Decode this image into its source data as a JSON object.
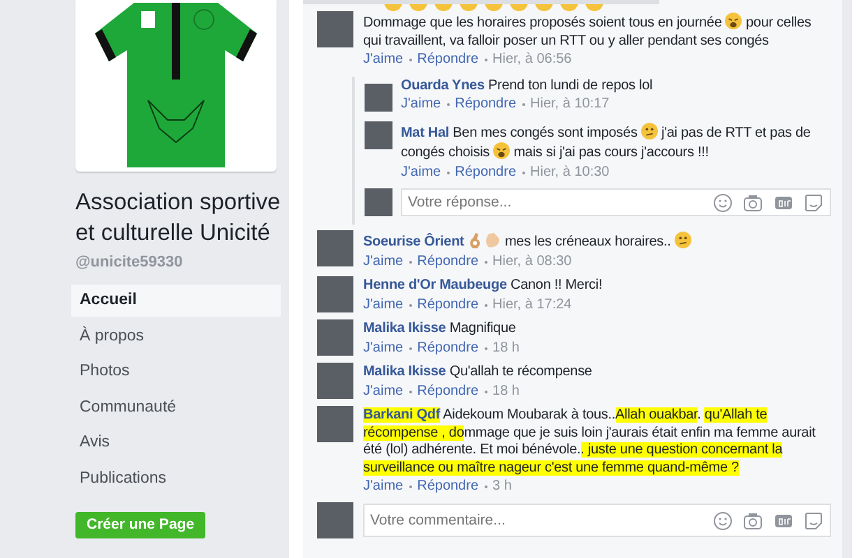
{
  "page": {
    "name": "Association sportive et culturelle Unicité",
    "handle": "@unicite59330",
    "nav": [
      {
        "label": "Accueil",
        "selected": true
      },
      {
        "label": "À propos",
        "selected": false
      },
      {
        "label": "Photos",
        "selected": false
      },
      {
        "label": "Communauté",
        "selected": false
      },
      {
        "label": "Avis",
        "selected": false
      },
      {
        "label": "Publications",
        "selected": false
      }
    ],
    "create_button": "Créer une Page"
  },
  "comments": [
    {
      "parts": [
        {
          "kind": "reactions"
        },
        {
          "kind": "text",
          "text": "Dommage que les horaires proposés soient tous en journée "
        },
        {
          "kind": "tired"
        },
        {
          "kind": "text",
          "text": " pour celles qui travaillent, va falloir poser un RTT ou y aller pendant ses congés"
        }
      ],
      "like": "J'aime",
      "reply": "Répondre",
      "time": "Hier, à 06:56",
      "replies": [
        {
          "author": "Ouarda Ynes",
          "parts": [
            {
              "kind": "text",
              "text": "Prend ton lundi de repos lol"
            }
          ],
          "like": "J'aime",
          "reply": "Répondre",
          "time": "Hier, à 10:17"
        },
        {
          "author": "Mat Hal",
          "parts": [
            {
              "kind": "text",
              "text": "Ben mes congés sont imposés "
            },
            {
              "kind": "confused"
            },
            {
              "kind": "text",
              "text": " j'ai pas de RTT et pas de congés choisis "
            },
            {
              "kind": "tired"
            },
            {
              "kind": "text",
              "text": " mais si j'ai pas cours j'accours !!!"
            }
          ],
          "like": "J'aime",
          "reply": "Répondre",
          "time": "Hier, à 10:30"
        }
      ],
      "reply_box": {
        "placeholder": "Votre réponse..."
      }
    },
    {
      "author": "Soeurise Ôrient",
      "parts": [
        {
          "kind": "okhand"
        },
        {
          "kind": "clap"
        },
        {
          "kind": "text",
          "text": " mes les créneaux horaires.. "
        },
        {
          "kind": "confused"
        }
      ],
      "like": "J'aime",
      "reply": "Répondre",
      "time": "Hier, à 08:30"
    },
    {
      "author": "Henne d'Or Maubeuge",
      "parts": [
        {
          "kind": "text",
          "text": "Canon !! Merci!"
        }
      ],
      "like": "J'aime",
      "reply": "Répondre",
      "time": "Hier, à 17:24"
    },
    {
      "author": "Malika Ikisse",
      "parts": [
        {
          "kind": "text",
          "text": "Magnifique"
        }
      ],
      "like": "J'aime",
      "reply": "Répondre",
      "time": "18 h"
    },
    {
      "author": "Malika Ikisse",
      "parts": [
        {
          "kind": "text",
          "text": "Qu'allah te récompense"
        }
      ],
      "like": "J'aime",
      "reply": "Répondre",
      "time": "18 h"
    },
    {
      "author": "Barkani Qdf",
      "author_highlighted": true,
      "parts": [
        {
          "kind": "text",
          "text": "Aidekoum Moubarak à tous..",
          "highlighted": false
        },
        {
          "kind": "text",
          "text": "Allah ouakbar",
          "highlighted": true
        },
        {
          "kind": "text",
          "text": ". ",
          "highlighted": false
        },
        {
          "kind": "text",
          "text": "qu'Allah te récompense , do",
          "highlighted": true
        },
        {
          "kind": "text",
          "text": "mmage que je suis loin j'aurais était enfin ma femme aurait été (lol) adhérente. Et moi bénévole.",
          "highlighted": false
        },
        {
          "kind": "text",
          "text": ". juste une question concernant la surveillance ou maître nageur c'est une femme quand-même ?",
          "highlighted": true
        }
      ],
      "like": "J'aime",
      "reply": "Répondre",
      "time": "3 h"
    }
  ],
  "comment_box": {
    "placeholder": "Votre commentaire..."
  }
}
